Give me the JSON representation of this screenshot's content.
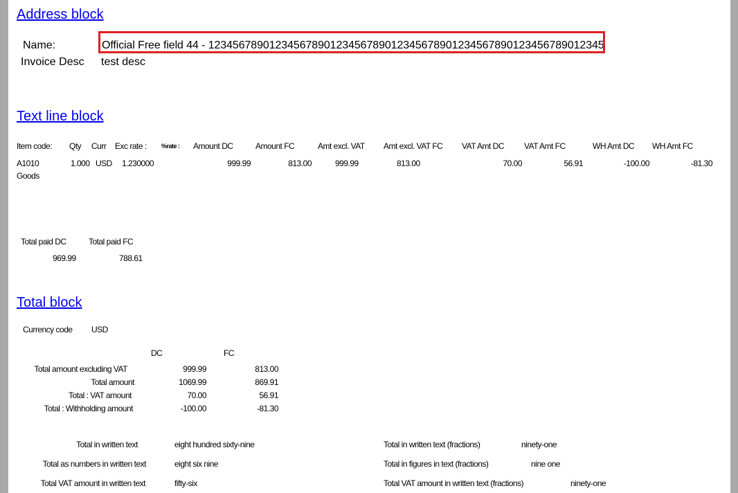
{
  "address_block": {
    "heading": "Address block",
    "name_label": "Name:",
    "name_value": "Official Free field 44 - 12345678901234567890123456789012345678901234567890123456789012345",
    "invoice_desc_label": "Invoice Desc",
    "invoice_desc_value": "test desc"
  },
  "text_line_block": {
    "heading": "Text line block",
    "headers": {
      "item_code": "Item code:",
      "qty": "Qty",
      "curr": "Curr",
      "exc_rate": "Exc rate :",
      "pct_rate": "%rate :",
      "amount_dc": "Amount DC",
      "amount_fc": "Amount FC",
      "amt_excl_vat": "Amt excl. VAT",
      "amt_excl_vat_fc": "Amt excl. VAT FC",
      "vat_amt_dc": "VAT Amt DC",
      "vat_amt_fc": "VAT Amt FC",
      "wh_amt_dc": "WH Amt DC",
      "wh_amt_fc": "WH Amt FC"
    },
    "row": {
      "item_code": "A1010",
      "description": "Goods",
      "qty": "1.000",
      "curr": "USD",
      "exc_rate": "1.230000",
      "amount_dc": "999.99",
      "amount_fc": "813.00",
      "amt_excl_vat": "999.99",
      "amt_excl_vat_fc": "813.00",
      "vat_amt_dc": "70.00",
      "vat_amt_fc": "56.91",
      "wh_amt_dc": "-100.00",
      "wh_amt_fc": "-81.30"
    },
    "total_paid_dc_label": "Total paid DC",
    "total_paid_fc_label": "Total paid FC",
    "total_paid_dc": "969.99",
    "total_paid_fc": "788.61"
  },
  "total_block": {
    "heading": "Total block",
    "currency_code_label": "Currency code",
    "currency_code": "USD",
    "col_dc": "DC",
    "col_fc": "FC",
    "rows": [
      {
        "label": "Total amount excluding VAT",
        "dc": "999.99",
        "fc": "813.00"
      },
      {
        "label": "Total amount",
        "dc": "1069.99",
        "fc": "869.91"
      },
      {
        "label": "Total : VAT amount",
        "dc": "70.00",
        "fc": "56.91"
      },
      {
        "label": "Total : Withholding amount",
        "dc": "-100.00",
        "fc": "-81.30"
      }
    ],
    "written": [
      {
        "label": "Total in written text",
        "value": "eight hundred sixty-nine"
      },
      {
        "label": "Total as numbers in written text",
        "value": "eight six nine"
      },
      {
        "label": "Total VAT amount in written text",
        "value": "fifty-six"
      }
    ],
    "fractions": [
      {
        "label": "Total in written text (fractions)",
        "value": "ninety-one"
      },
      {
        "label": "Total in figures in text (fractions)",
        "value": "nine one"
      },
      {
        "label": "Total VAT amount in written text (fractions)",
        "value": "ninety-one"
      }
    ]
  }
}
